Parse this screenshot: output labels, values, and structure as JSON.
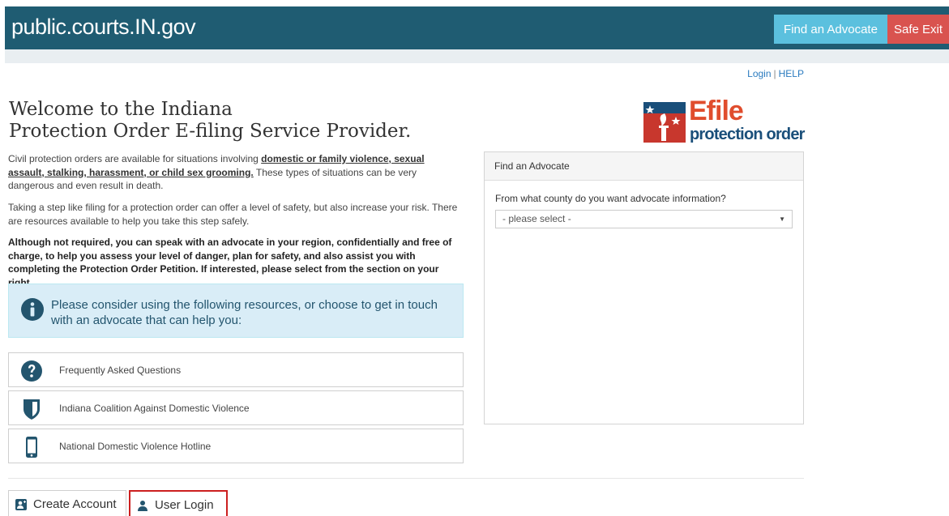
{
  "header": {
    "brand": "public.courts.IN.gov",
    "find_advocate_label": "Find an Advocate",
    "safe_exit_label": "Safe Exit",
    "bar_color": "#1f5c72"
  },
  "top_links": {
    "login": "Login",
    "separator": "|",
    "help": "HELP"
  },
  "welcome": {
    "line1": "Welcome to the Indiana",
    "line2": "Protection Order E-filing Service Provider."
  },
  "logo": {
    "efile": "Efile",
    "subtitle": "protection order"
  },
  "intro": {
    "p1_before": "Civil protection orders are available for situations involving ",
    "p1_link": "domestic or family violence, sexual assault, stalking, harassment, or child sex grooming.",
    "p1_after": " These types of situations can be very dangerous and even result in death.",
    "p2": "Taking a step like filing for a protection order can offer a level of safety, but also increase your risk. There are resources available to help you take this step safely.",
    "p3": "Although not required, you can speak with an advocate in your region, confidentially and free of charge, to help you assess your level of danger, plan for safety, and also assist you with completing the Protection Order Petition. If interested, please select from the section on your right."
  },
  "info": {
    "text": "Please consider using the following resources, or choose to get in touch with an advocate that can help you:",
    "icon": "info-circle-icon"
  },
  "resources": [
    {
      "label": "Frequently Asked Questions",
      "icon": "question-circle-icon"
    },
    {
      "label": "Indiana Coalition Against Domestic Violence",
      "icon": "shield-icon"
    },
    {
      "label": "National Domestic Violence Hotline",
      "icon": "mobile-phone-icon"
    }
  ],
  "advocate_panel": {
    "title": "Find an Advocate",
    "question": "From what county do you want advocate information?",
    "select_value": "- please select -"
  },
  "tabs": {
    "create_account": "Create Account",
    "user_login": "User Login"
  },
  "colors": {
    "accent_blue": "#5bc0de",
    "danger_red": "#d9534f",
    "highlight_red": "#cc1f1f",
    "info_bg": "#d9edf7",
    "logo_red": "#e04d2d",
    "logo_navy": "#1a4f7a"
  }
}
